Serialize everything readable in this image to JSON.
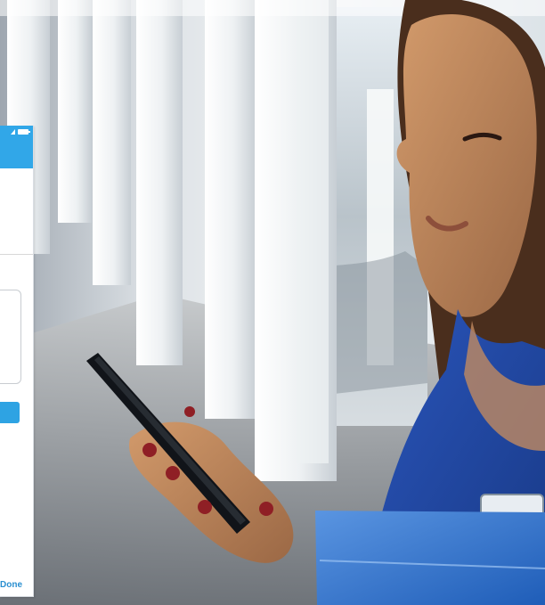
{
  "phone": {
    "done_label": "Done",
    "accent_color": "#31a7e8",
    "button_color": "#2ea3e3",
    "status_icons": [
      "signal-icon",
      "battery-icon"
    ]
  },
  "photo": {
    "colors": {
      "uniform": "#2145a7",
      "folder": "#3c78d2",
      "window_light": "#e6edf2",
      "floor": "#8b8f94"
    }
  }
}
